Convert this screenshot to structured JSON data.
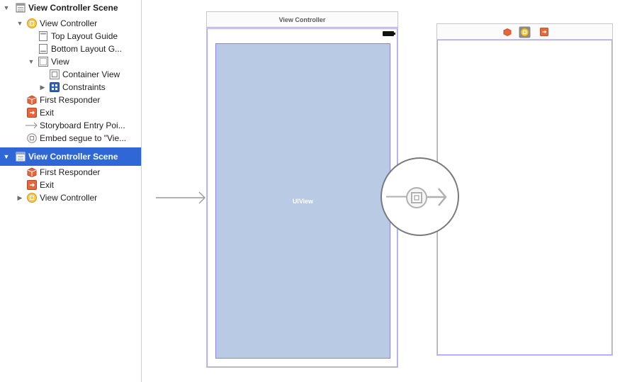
{
  "outline": {
    "scene1": {
      "title": "View Controller Scene",
      "view_controller": "View Controller",
      "top_layout_guide": "Top Layout Guide",
      "bottom_layout_guide": "Bottom Layout G...",
      "view": "View",
      "container_view": "Container View",
      "constraints": "Constraints",
      "first_responder": "First Responder",
      "exit": "Exit",
      "storyboard_entry": "Storyboard Entry Poi...",
      "embed_segue": "Embed segue to \"Vie..."
    },
    "scene2": {
      "title": "View Controller Scene",
      "first_responder": "First Responder",
      "exit": "Exit",
      "view_controller": "View Controller"
    }
  },
  "canvas": {
    "vc1_title": "View Controller",
    "uiview_label": "UIView"
  },
  "icons": {
    "scene": "scene-icon",
    "view_controller": "view-controller-icon",
    "layout_guide": "layout-guide-icon",
    "view": "view-icon",
    "container_view": "container-view-icon",
    "constraints": "constraints-icon",
    "first_responder": "first-responder-icon",
    "exit": "exit-icon",
    "entry_arrow": "arrow-right-icon",
    "embed_segue": "embed-segue-icon"
  },
  "colors": {
    "selection": "#2f67d6",
    "uiview_fill": "#b8cae4",
    "view_outline": "#a9a6ee",
    "vc_yellow": "#f2c94c",
    "responder_orange": "#e8663c"
  }
}
